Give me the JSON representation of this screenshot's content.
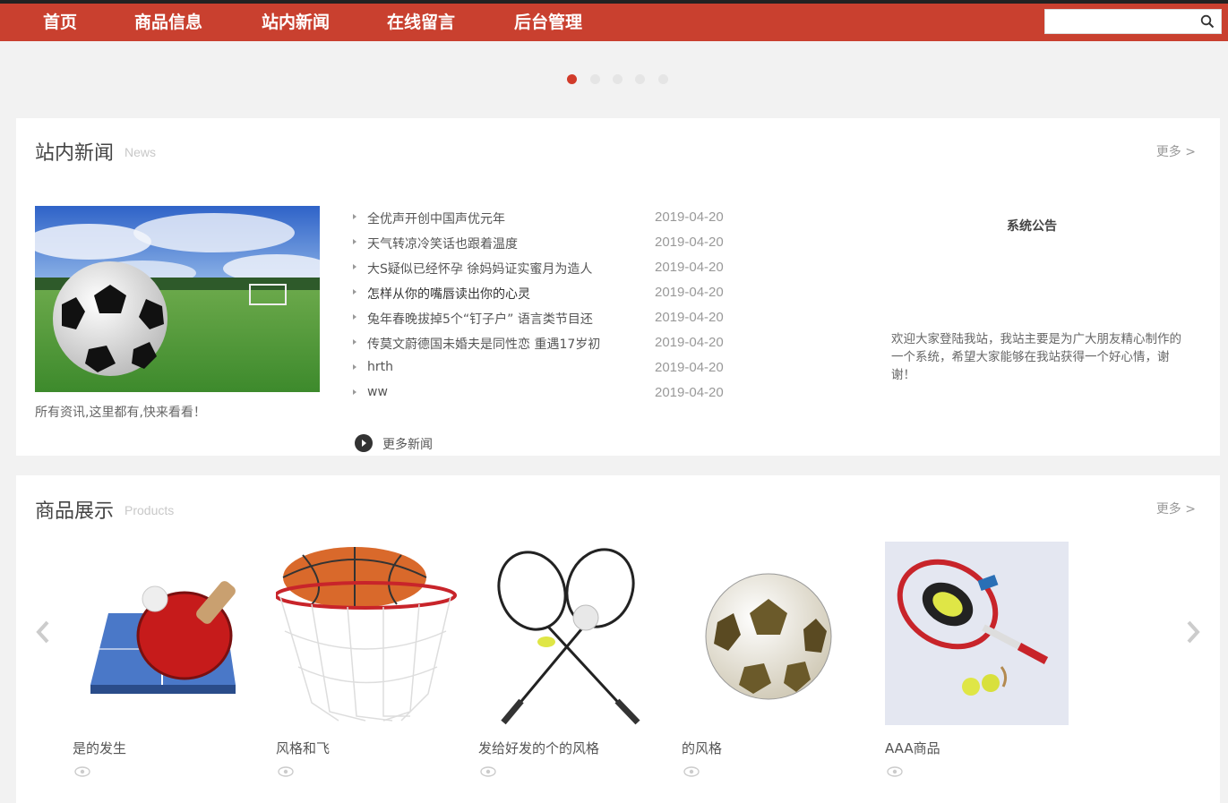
{
  "nav": {
    "items": [
      "首页",
      "商品信息",
      "站内新闻",
      "在线留言",
      "后台管理"
    ],
    "search_placeholder": ""
  },
  "carousel": {
    "dot_count": 5,
    "active_index": 0
  },
  "news": {
    "title": "站内新闻",
    "subtitle": "News",
    "more": "更多 >",
    "caption": "所有资讯,这里都有,快来看看！",
    "items": [
      {
        "title": "全优声开创中国声优元年",
        "date": "2019-04-20"
      },
      {
        "title": "天气转凉冷笑话也跟着温度",
        "date": "2019-04-20"
      },
      {
        "title": "大S疑似已经怀孕 徐妈妈证实蜜月为造人",
        "date": "2019-04-20"
      },
      {
        "title": "怎样从你的嘴唇读出你的心灵",
        "date": "2019-04-20"
      },
      {
        "title": "兔年春晚拔掉5个“钉子户” 语言类节目还",
        "date": "2019-04-20"
      },
      {
        "title": "传莫文蔚德国未婚夫是同性恋 重遇17岁初",
        "date": "2019-04-20"
      },
      {
        "title": "hrth",
        "date": "2019-04-20"
      },
      {
        "title": "ww",
        "date": "2019-04-20"
      }
    ],
    "more_news": "更多新闻"
  },
  "notice": {
    "title": "系统公告",
    "body": "欢迎大家登陆我站，我站主要是为广大朋友精心制作的一个系统，希望大家能够在我站获得一个好心情，谢谢！"
  },
  "products": {
    "title": "商品展示",
    "subtitle": "Products",
    "more": "更多 >",
    "items": [
      {
        "name": "是的发生",
        "icon": "table-tennis-image"
      },
      {
        "name": "风格和飞",
        "icon": "basketball-hoop-image"
      },
      {
        "name": "发给好发的个的风格",
        "icon": "badminton-image"
      },
      {
        "name": "的风格",
        "icon": "soccer-ball-image"
      },
      {
        "name": "AAA商品",
        "icon": "tennis-racket-image"
      }
    ]
  },
  "colors": {
    "nav_bg": "#c9402f",
    "accent": "#d13b2a"
  }
}
